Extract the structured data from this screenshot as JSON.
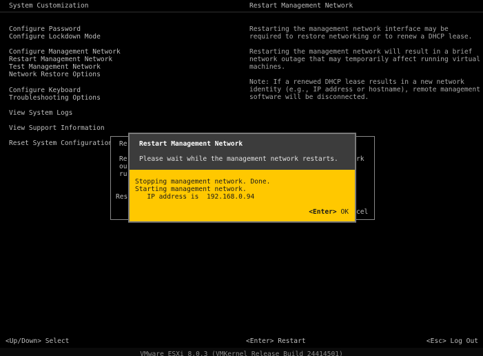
{
  "header": {
    "left_title": "System Customization",
    "right_title": "Restart Management Network"
  },
  "menu": [
    {
      "label": "Configure Password"
    },
    {
      "label": "Configure Lockdown Mode"
    },
    {
      "label": "Configure Management Network"
    },
    {
      "label": "Restart Management Network"
    },
    {
      "label": "Test Management Network"
    },
    {
      "label": "Network Restore Options"
    },
    {
      "label": "Configure Keyboard"
    },
    {
      "label": "Troubleshooting Options"
    },
    {
      "label": "View System Logs"
    },
    {
      "label": "View Support Information"
    },
    {
      "label": "Reset System Configuration"
    }
  ],
  "description": {
    "p1": "Restarting the management network interface may be required to restore networking or to renew a DHCP lease.",
    "p2": "Restarting the management network will result in a brief network outage that may temporarily affect running virtual machines.",
    "p3": "Note: If a renewed DHCP lease results in a new network identity (e.g., IP address or hostname), remote management software will be disconnected."
  },
  "bg_dialog": {
    "frag_title": "Re",
    "frag_line1": "Re",
    "frag_line2": "ou",
    "frag_line3": "ru",
    "frag_right": "rk",
    "frag_bottom_left": "Res",
    "frag_bottom_right": "cel"
  },
  "dialog": {
    "title": "Restart Management Network",
    "message": "Please wait while the management network restarts.",
    "line1": "Stopping management network. Done.",
    "line2": "Starting management network.",
    "line3": "   IP address is  192.168.0.94",
    "ok_key": "<Enter>",
    "ok_label": " OK"
  },
  "hints": {
    "left": "<Up/Down> Select",
    "center": "<Enter> Restart",
    "right": "<Esc> Log Out"
  },
  "footer": "VMware ESXi 8.0.3 (VMKernel Release Build 24414501)"
}
